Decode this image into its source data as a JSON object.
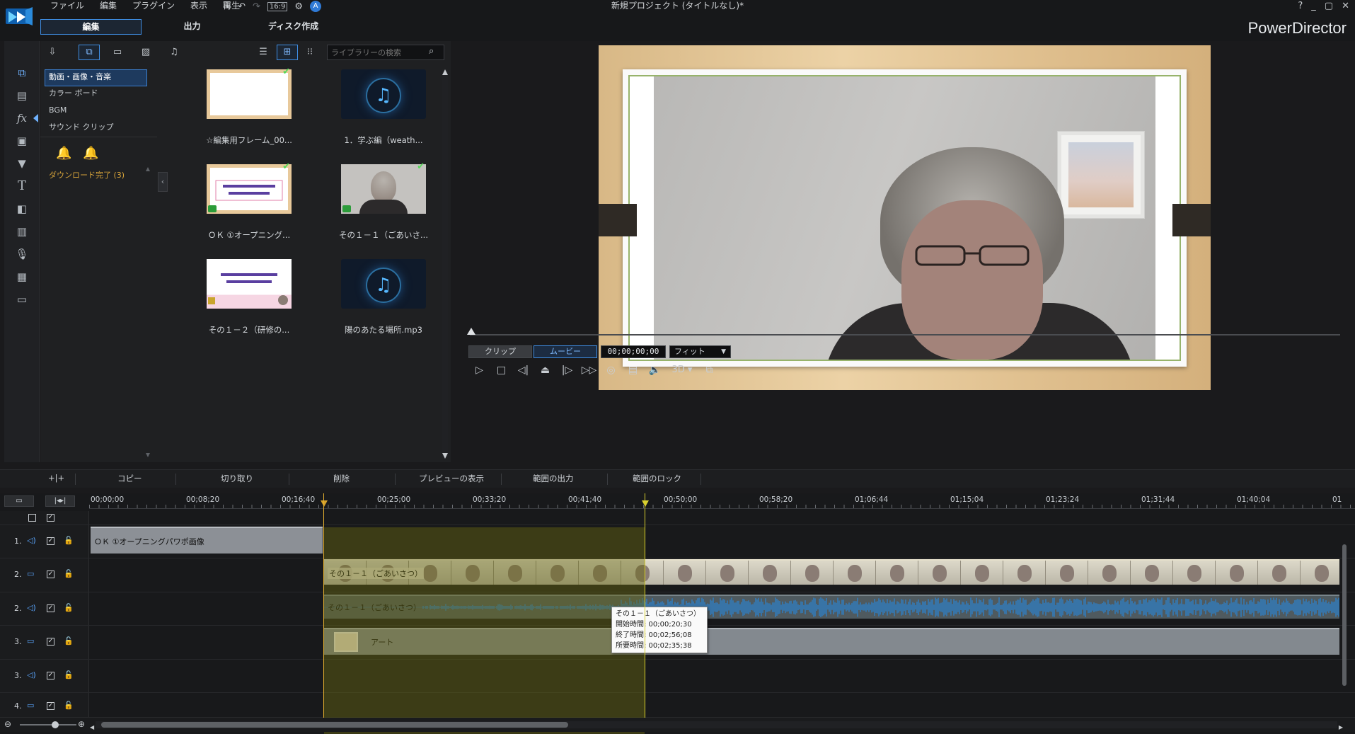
{
  "app": {
    "window_title": "新規プロジェクト (タイトルなし)*",
    "brand": "PowerDirector",
    "menu": [
      "ファイル",
      "編集",
      "プラグイン",
      "表示",
      "再生"
    ],
    "aspect_ratio": "16:9",
    "window_controls": [
      "?",
      "_",
      "▢",
      "✕"
    ]
  },
  "mode_tabs": [
    {
      "label": "編集",
      "active": true
    },
    {
      "label": "出力",
      "active": false
    },
    {
      "label": "ディスク作成",
      "active": false
    }
  ],
  "library": {
    "search_placeholder": "ライブラリーの検索",
    "categories": [
      "動画・画像・音楽",
      "カラー ボード",
      "BGM",
      "サウンド クリップ"
    ],
    "selected_category": "動画・画像・音楽",
    "download_done": "ダウンロード完了 (3)",
    "items": [
      {
        "label": "☆編集用フレーム_00...",
        "type": "frame",
        "checked": true
      },
      {
        "label": "1．学ぶ編（weath...",
        "type": "music",
        "checked": false
      },
      {
        "label": "ＯＫ ①オープニング...",
        "type": "slide",
        "checked": true
      },
      {
        "label": "その１－１（ごあいさ...",
        "type": "video",
        "checked": true
      },
      {
        "label": "その１－２（研修の...",
        "type": "slide2",
        "checked": false
      },
      {
        "label": "陽のあたる場所.mp3",
        "type": "music",
        "checked": false
      }
    ]
  },
  "preview": {
    "mode_clip": "クリップ",
    "mode_movie": "ムービー",
    "timecode": "00;00;00;00",
    "fit": "フィット",
    "threed": "3D"
  },
  "edit_toolbar": {
    "copy": "コピー",
    "cut": "切り取り",
    "delete": "削除",
    "preview": "プレビューの表示",
    "range_export": "範囲の出力",
    "range_lock": "範囲のロック"
  },
  "timeline": {
    "ruler": [
      "00;00;00",
      "00;08;20",
      "00;16;40",
      "00;25;00",
      "00;33;20",
      "00;41;40",
      "00;50;00",
      "00;58;20",
      "01;06;44",
      "01;15;04",
      "01;23;24",
      "01;31;44",
      "01;40;04",
      "01"
    ],
    "tracks": [
      {
        "num": "1.",
        "kind": "audio"
      },
      {
        "num": "2.",
        "kind": "video"
      },
      {
        "num": "2.",
        "kind": "audio"
      },
      {
        "num": "3.",
        "kind": "video"
      },
      {
        "num": "3.",
        "kind": "audio"
      },
      {
        "num": "4.",
        "kind": "video"
      }
    ],
    "clips": {
      "t1": "ＯＫ ①オープニングパワポ画像",
      "t2_video": "その１－１（ごあいさつ）",
      "t2_audio": "その１－１（ごあいさつ）",
      "t3": "アート"
    },
    "tooltip": {
      "title": "その１－１（ごあいさつ）",
      "start": "開始時間: 00;00;20;30",
      "end": "終了時間: 00;02;56;08",
      "duration": "所要時間: 00;02;35;38"
    }
  }
}
